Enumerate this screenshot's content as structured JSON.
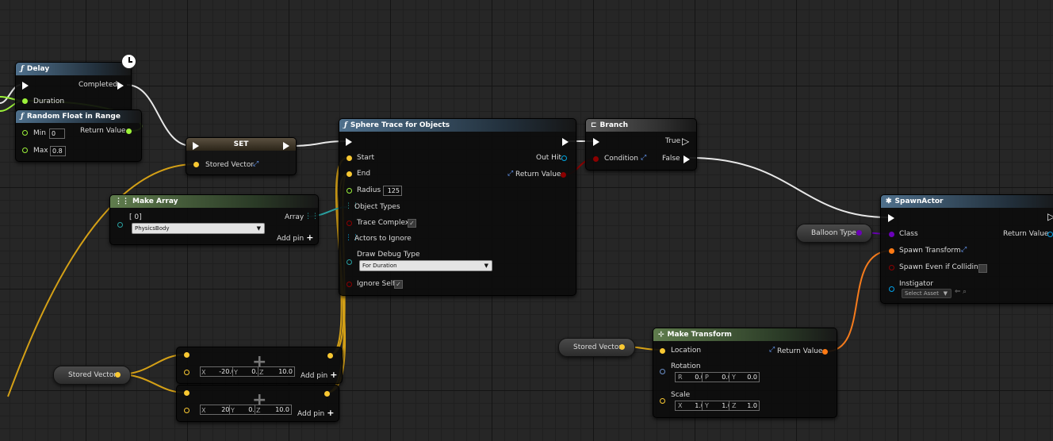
{
  "colors": {
    "exec": "#ffffff",
    "float": "#9cf23a",
    "vector": "#f9c832",
    "struct": "#00a6e0",
    "transform": "#ff7a14",
    "bool": "#8c0000",
    "class": "#6b00b8",
    "object": "#02a0e8",
    "array_ref": "#2aa0a0",
    "wire_exec": "#ffffff",
    "wire_vector": "#d4a016",
    "wire_float": "#9cf23a",
    "wire_transform": "#f57b1c",
    "wire_class": "#6b00b8"
  },
  "delay": {
    "title": "Delay",
    "icon": "function-icon",
    "completed": "Completed",
    "duration": "Duration"
  },
  "random_float": {
    "title": "Random Float in Range",
    "min_label": "Min",
    "min_value": "0",
    "max_label": "Max",
    "max_value": "0.8",
    "return_value": "Return Value"
  },
  "set_node": {
    "title": "SET",
    "stored_vector": "Stored Vector"
  },
  "make_array": {
    "title": "Make Array",
    "index": "[ 0]",
    "array": "Array",
    "value": "PhysicsBody",
    "add_pin": "Add pin"
  },
  "sphere_trace": {
    "title": "Sphere Trace for Objects",
    "start": "Start",
    "end": "End",
    "radius": "Radius",
    "radius_value": "125",
    "object_types": "Object Types",
    "trace_complex": "Trace Complex",
    "actors_to_ignore": "Actors to Ignore",
    "draw_debug_type": "Draw Debug Type",
    "draw_debug_value": "For Duration",
    "ignore_self": "Ignore Self",
    "out_hit": "Out Hit",
    "return_value": "Return Value"
  },
  "branch": {
    "title": "Branch",
    "true_label": "True",
    "condition": "Condition",
    "false_label": "False"
  },
  "spawn_actor": {
    "title": "SpawnActor",
    "class": "Class",
    "spawn_transform": "Spawn Transform",
    "spawn_even": "Spawn Even if Colliding",
    "instigator": "Instigator",
    "instigator_value": "Select Asset",
    "return_value": "Return Value"
  },
  "balloon_type": "Balloon Type",
  "stored_vector_left": "Stored Vector",
  "stored_vector_right": "Stored Vector",
  "make_vector_1": {
    "x": "-20.0",
    "y": "0.0",
    "z": "10.0",
    "x_label": "X",
    "y_label": "Y",
    "z_label": "Z",
    "add_pin": "Add pin"
  },
  "make_vector_2": {
    "x": "20.0",
    "y": "0.0",
    "z": "10.0",
    "x_label": "X",
    "y_label": "Y",
    "z_label": "Z",
    "add_pin": "Add pin"
  },
  "make_transform": {
    "title": "Make Transform",
    "location": "Location",
    "return_value": "Return Value",
    "rotation": "Rotation",
    "rot_r": "0.0",
    "rot_p": "0.0",
    "rot_y": "0.0",
    "r_label": "R",
    "p_label": "P",
    "y_label": "Y",
    "scale": "Scale",
    "scale_x": "1.0",
    "scale_y": "1.0",
    "scale_z": "1.0",
    "x_label": "X",
    "sy_label": "Y",
    "z_label": "Z"
  }
}
